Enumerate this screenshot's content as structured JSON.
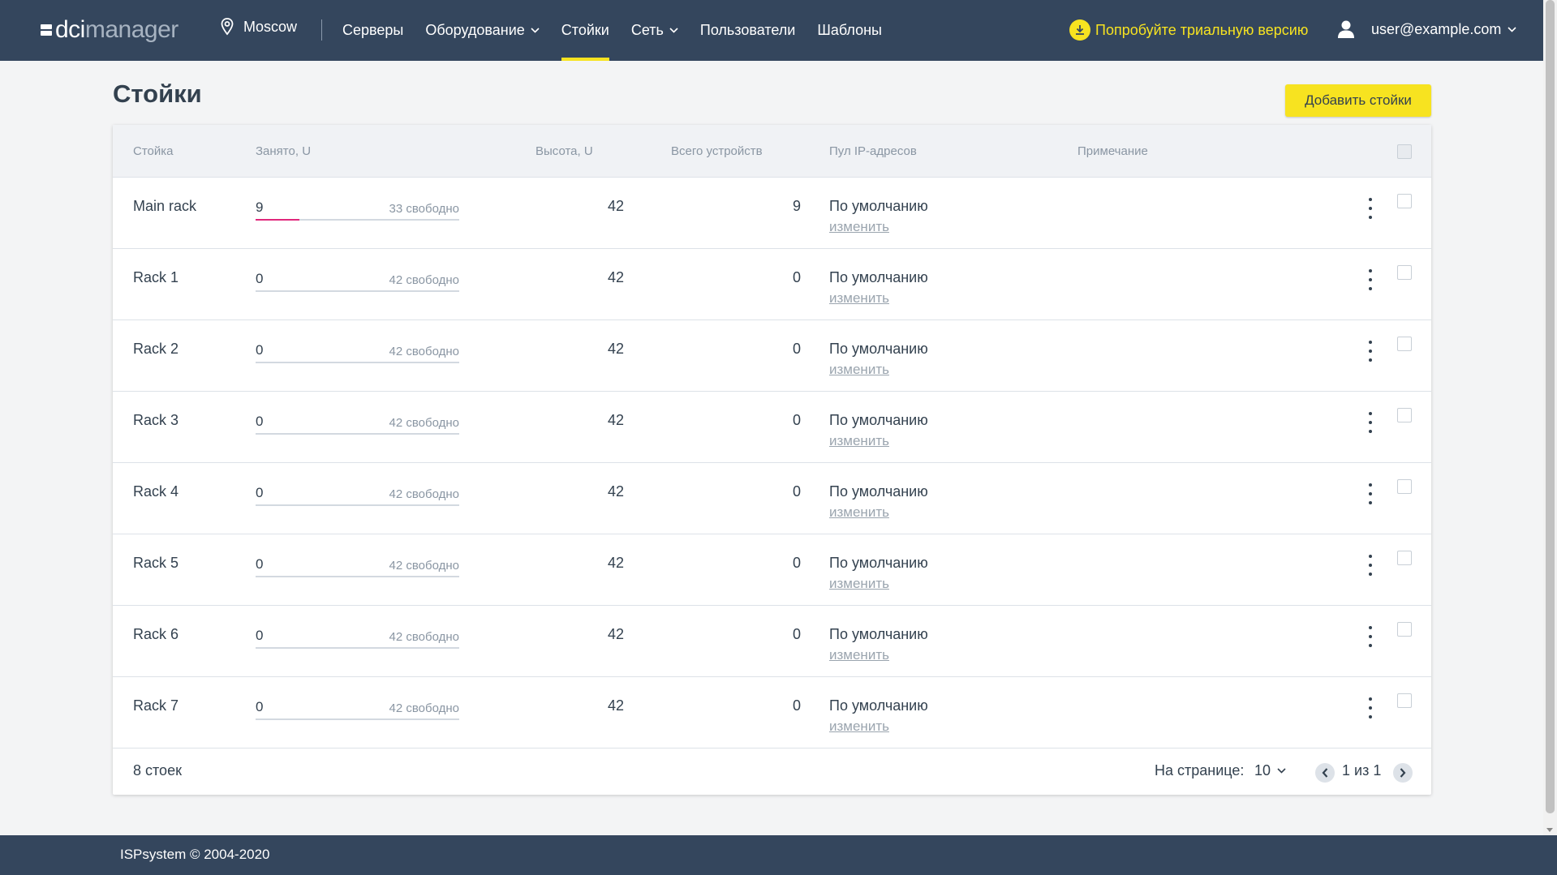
{
  "app": {
    "logo_dci": "dci",
    "logo_manager": "manager",
    "location": "Moscow",
    "trial_label": "Попробуйте триальную версию",
    "user_email": "user@example.com"
  },
  "nav": [
    {
      "label": "Серверы"
    },
    {
      "label": "Оборудование"
    },
    {
      "label": "Стойки"
    },
    {
      "label": "Сеть"
    },
    {
      "label": "Пользователи"
    },
    {
      "label": "Шаблоны"
    }
  ],
  "page": {
    "title": "Стойки",
    "add_button": "Добавить стойки"
  },
  "table": {
    "columns": [
      "Стойка",
      "Занято, U",
      "Высота, U",
      "Всего устройств",
      "Пул IP-адресов",
      "Примечание"
    ],
    "rows": [
      {
        "name": "Main rack",
        "occupied": "9",
        "free": "33 свободно",
        "occupied_fraction": 0.214,
        "height": "42",
        "devices": "9",
        "pool": "По умолчанию",
        "change": "изменить"
      },
      {
        "name": "Rack 1",
        "occupied": "0",
        "free": "42 свободно",
        "occupied_fraction": 0,
        "height": "42",
        "devices": "0",
        "pool": "По умолчанию",
        "change": "изменить"
      },
      {
        "name": "Rack 2",
        "occupied": "0",
        "free": "42 свободно",
        "occupied_fraction": 0,
        "height": "42",
        "devices": "0",
        "pool": "По умолчанию",
        "change": "изменить"
      },
      {
        "name": "Rack 3",
        "occupied": "0",
        "free": "42 свободно",
        "occupied_fraction": 0,
        "height": "42",
        "devices": "0",
        "pool": "По умолчанию",
        "change": "изменить"
      },
      {
        "name": "Rack 4",
        "occupied": "0",
        "free": "42 свободно",
        "occupied_fraction": 0,
        "height": "42",
        "devices": "0",
        "pool": "По умолчанию",
        "change": "изменить"
      },
      {
        "name": "Rack 5",
        "occupied": "0",
        "free": "42 свободно",
        "occupied_fraction": 0,
        "height": "42",
        "devices": "0",
        "pool": "По умолчанию",
        "change": "изменить"
      },
      {
        "name": "Rack 6",
        "occupied": "0",
        "free": "42 свободно",
        "occupied_fraction": 0,
        "height": "42",
        "devices": "0",
        "pool": "По умолчанию",
        "change": "изменить"
      },
      {
        "name": "Rack 7",
        "occupied": "0",
        "free": "42 свободно",
        "occupied_fraction": 0,
        "height": "42",
        "devices": "0",
        "pool": "По умолчанию",
        "change": "изменить"
      }
    ],
    "footer": {
      "count": "8 стоек",
      "per_page_label": "На странице:",
      "per_page_value": "10",
      "pagination": "1 из 1"
    }
  },
  "footer": {
    "copyright": "ISPsystem © 2004-2020"
  },
  "colors": {
    "topbar": "#34465d",
    "accent": "#f7e320",
    "progress": "#e0287c"
  },
  "icons": [
    "location-pin-icon",
    "chevron-down-icon",
    "download-icon",
    "user-icon",
    "kebab-menu-icon",
    "chevron-left-icon",
    "chevron-right-icon"
  ]
}
